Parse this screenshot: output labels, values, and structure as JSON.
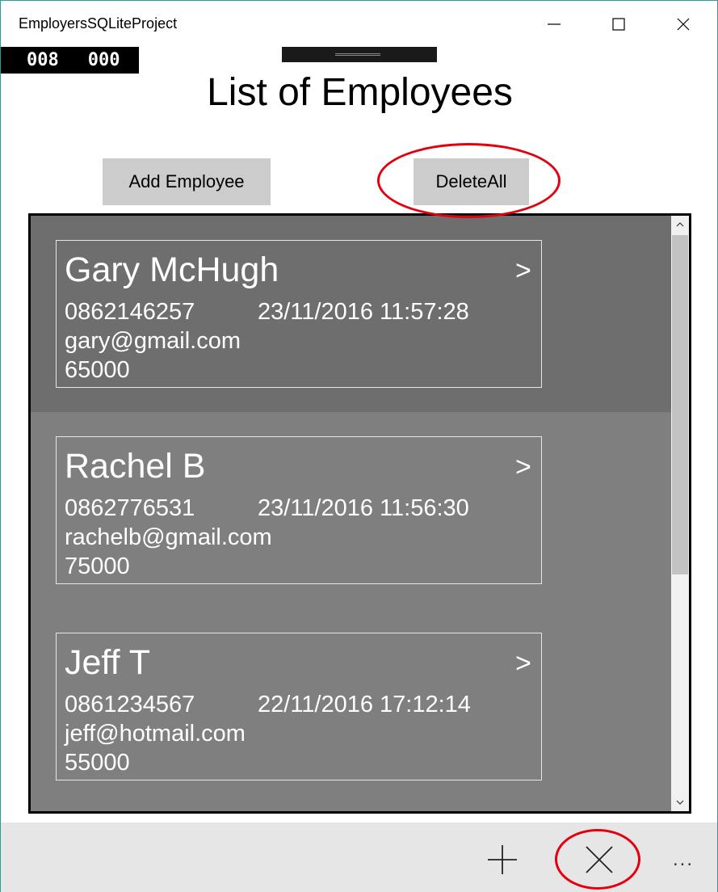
{
  "window": {
    "title": "EmployersSQLiteProject",
    "minimize_icon": "minimize-icon",
    "maximize_icon": "maximize-icon",
    "close_icon": "close-icon"
  },
  "frame_counter": {
    "a": "008",
    "b": "000"
  },
  "page": {
    "title": "List of Employees"
  },
  "toolbar": {
    "add_label": "Add Employee",
    "delete_all_label": "DeleteAll"
  },
  "employees": [
    {
      "name": "Gary McHugh",
      "phone": "0862146257",
      "date": "23/11/2016 11:57:28",
      "email": "gary@gmail.com",
      "salary": "65000",
      "arrow": ">"
    },
    {
      "name": "Rachel B",
      "phone": "0862776531",
      "date": "23/11/2016 11:56:30",
      "email": "rachelb@gmail.com",
      "salary": "75000",
      "arrow": ">"
    },
    {
      "name": "Jeff T",
      "phone": "0861234567",
      "date": "22/11/2016 17:12:14",
      "email": "jeff@hotmail.com",
      "salary": "55000",
      "arrow": ">"
    }
  ],
  "command_bar": {
    "add_icon": "plus-icon",
    "delete_icon": "cancel-icon",
    "more_label": "..."
  },
  "colors": {
    "annotation": "#e3000f",
    "list_background": "#7f7f7f",
    "selected_item": "#6e6e6e",
    "button_background": "#cccccc",
    "command_bar": "#e6e6e6"
  }
}
